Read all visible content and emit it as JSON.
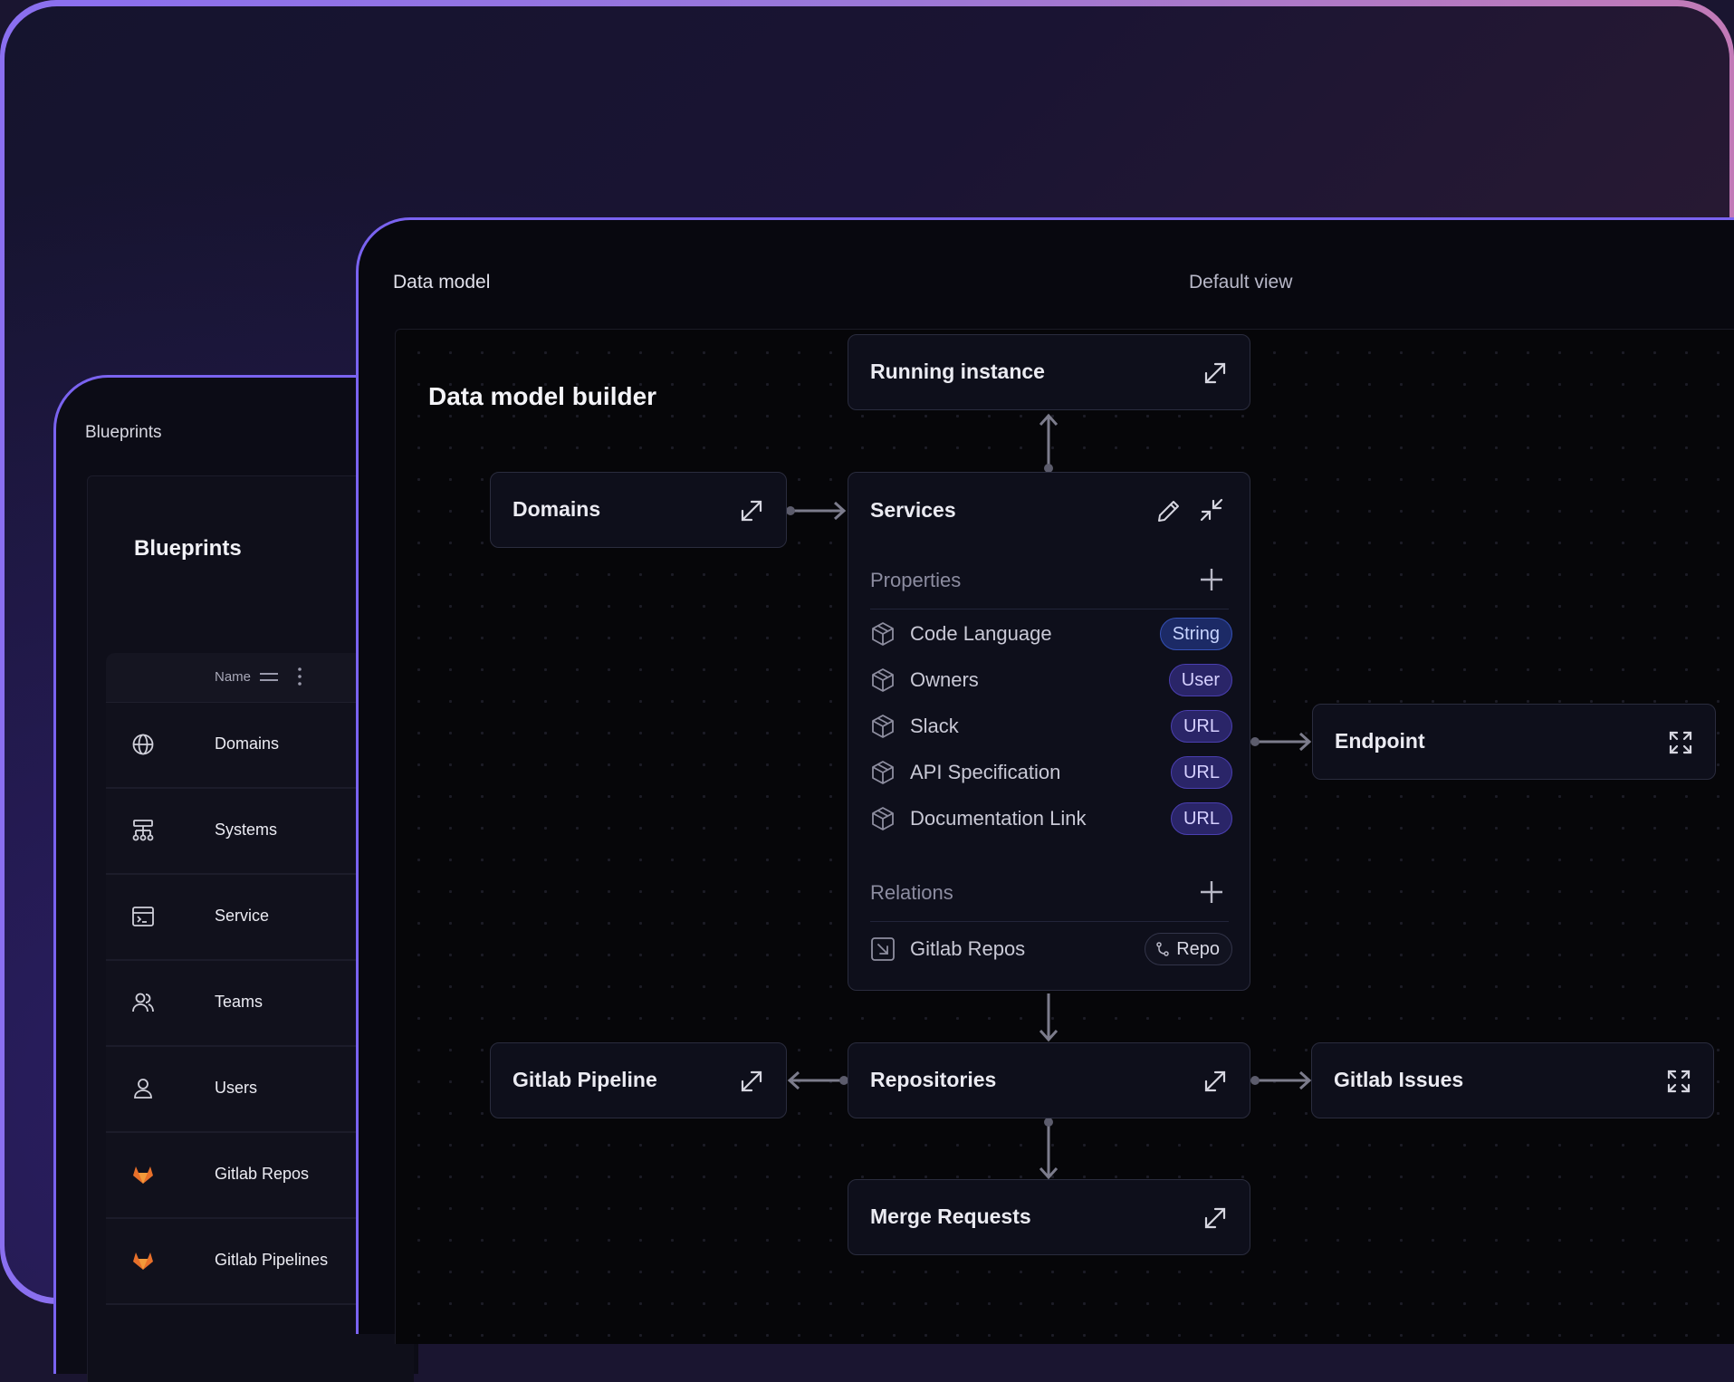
{
  "back_panel": {
    "label": "Blueprints",
    "card_title": "Blueprints",
    "column_header": "Name",
    "rows": [
      {
        "label": "Domains",
        "icon": "globe-icon"
      },
      {
        "label": "Systems",
        "icon": "hierarchy-icon"
      },
      {
        "label": "Service",
        "icon": "terminal-window-icon"
      },
      {
        "label": "Teams",
        "icon": "users-icon"
      },
      {
        "label": "Users",
        "icon": "user-icon"
      },
      {
        "label": "Gitlab Repos",
        "icon": "gitlab-icon"
      },
      {
        "label": "Gitlab Pipelines",
        "icon": "gitlab-icon"
      }
    ]
  },
  "main_panel": {
    "header_left": "Data model",
    "header_right": "Default view",
    "canvas_title": "Data model builder"
  },
  "nodes": {
    "running_instance": "Running instance",
    "domains": "Domains",
    "services": "Services",
    "endpoint": "Endpoint",
    "gitlab_pipeline": "Gitlab Pipeline",
    "repositories": "Repositories",
    "gitlab_issues": "Gitlab Issues",
    "merge_requests": "Merge Requests"
  },
  "services": {
    "properties_title": "Properties",
    "properties": [
      {
        "name": "Code Language",
        "type": "String"
      },
      {
        "name": "Owners",
        "type": "User"
      },
      {
        "name": "Slack",
        "type": "URL"
      },
      {
        "name": "API Specification",
        "type": "URL"
      },
      {
        "name": "Documentation Link",
        "type": "URL"
      }
    ],
    "relations_title": "Relations",
    "relations": [
      {
        "name": "Gitlab Repos",
        "target": "Repo"
      }
    ]
  },
  "colors": {
    "accent_border": "#7a63f0",
    "string_badge": "#1c2a66",
    "url_badge": "#2a2568",
    "gitlab_orange": "#e8702a"
  }
}
